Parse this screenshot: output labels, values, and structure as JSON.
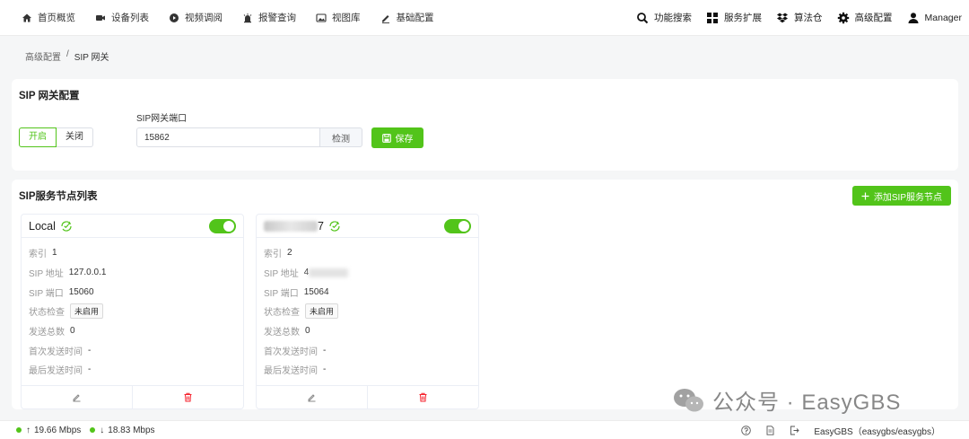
{
  "nav": {
    "left": [
      {
        "label": "首页概览",
        "icon": "home-icon"
      },
      {
        "label": "设备列表",
        "icon": "video-camera-icon"
      },
      {
        "label": "视频调阅",
        "icon": "play-circle-icon"
      },
      {
        "label": "报警查询",
        "icon": "alarm-icon"
      },
      {
        "label": "视图库",
        "icon": "image-icon"
      },
      {
        "label": "基础配置",
        "icon": "pencil-icon"
      }
    ],
    "right": [
      {
        "label": "功能搜索",
        "icon": "search-icon"
      },
      {
        "label": "服务扩展",
        "icon": "grid-icon"
      },
      {
        "label": "算法仓",
        "icon": "dropbox-icon"
      },
      {
        "label": "高级配置",
        "icon": "gear-icon"
      },
      {
        "label": "Manager",
        "icon": "user-icon"
      }
    ]
  },
  "breadcrumb": {
    "parent": "高级配置",
    "sep": "/",
    "current": "SIP 网关"
  },
  "gateway": {
    "title": "SIP 网关配置",
    "on_label": "开启",
    "off_label": "关闭",
    "port_label": "SIP网关端口",
    "port_value": "15862",
    "check_label": "检测",
    "save_label": "保存"
  },
  "nodes_section": {
    "title": "SIP服务节点列表",
    "add_label": "添加SIP服务节点"
  },
  "field_labels": {
    "index": "索引",
    "address": "SIP 地址",
    "port": "SIP 端口",
    "health": "状态检查",
    "sent_total": "发送总数",
    "first_sent": "首次发送时间",
    "last_sent": "最后发送时间"
  },
  "nodes": [
    {
      "name": "Local",
      "enabled": true,
      "index": "1",
      "address": "127.0.0.1",
      "port": "15060",
      "health": "未启用",
      "sent_total": "0",
      "first_sent": "-",
      "last_sent": "-"
    },
    {
      "name": "7",
      "enabled": true,
      "index": "2",
      "address": "4",
      "port": "15064",
      "health": "未启用",
      "sent_total": "0",
      "first_sent": "-",
      "last_sent": "-"
    }
  ],
  "watermark": {
    "text": "公众号 · EasyGBS"
  },
  "status": {
    "upload": "19.66 Mbps",
    "download": "18.83 Mbps",
    "product": "EasyGBS（easygbs/easygbs）"
  },
  "colors": {
    "accent": "#52c41a",
    "danger": "#f5222d"
  }
}
